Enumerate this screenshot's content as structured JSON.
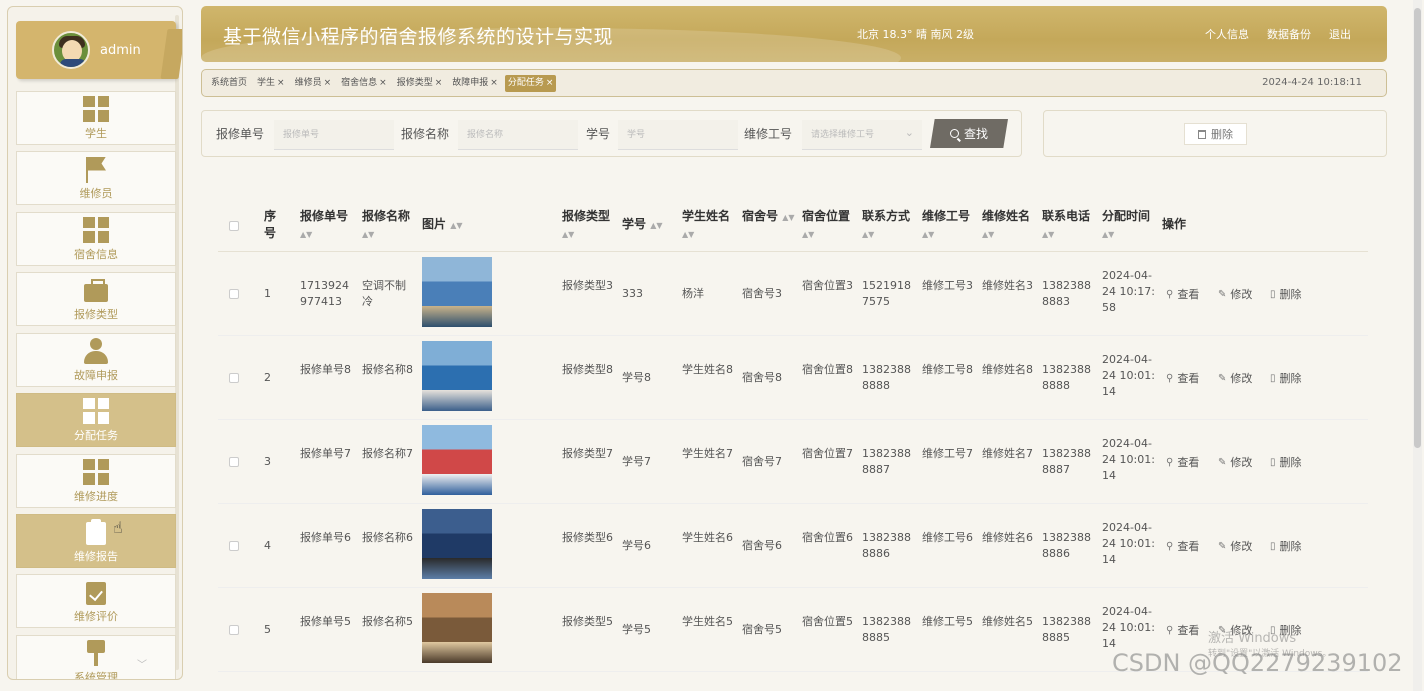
{
  "sidebar": {
    "username": "admin",
    "items": [
      {
        "label": "学生",
        "icon": "grid-icon"
      },
      {
        "label": "维修员",
        "icon": "flag-icon"
      },
      {
        "label": "宿舍信息",
        "icon": "grid-icon"
      },
      {
        "label": "报修类型",
        "icon": "briefcase-icon"
      },
      {
        "label": "故障申报",
        "icon": "user-icon"
      },
      {
        "label": "分配任务",
        "icon": "grid-icon"
      },
      {
        "label": "维修进度",
        "icon": "grid-icon"
      },
      {
        "label": "维修报告",
        "icon": "clipboard-icon"
      },
      {
        "label": "维修评价",
        "icon": "checklist-icon"
      },
      {
        "label": "系统管理",
        "icon": "brush-icon"
      }
    ]
  },
  "header": {
    "title": "基于微信小程序的宿舍报修系统的设计与实现",
    "weather": "北京  18.3°  晴  南风  2级",
    "links": [
      "个人信息",
      "数据备份",
      "退出"
    ]
  },
  "tabs": [
    {
      "label": "系统首页",
      "closable": false
    },
    {
      "label": "学生",
      "closable": true
    },
    {
      "label": "维修员",
      "closable": true
    },
    {
      "label": "宿舍信息",
      "closable": true
    },
    {
      "label": "报修类型",
      "closable": true
    },
    {
      "label": "故障申报",
      "closable": true
    },
    {
      "label": "分配任务",
      "closable": true
    }
  ],
  "datetime": "2024-4-24 10:18:11",
  "search": {
    "fields": [
      {
        "label": "报修单号",
        "placeholder": "报修单号"
      },
      {
        "label": "报修名称",
        "placeholder": "报修名称"
      },
      {
        "label": "学号",
        "placeholder": "学号"
      },
      {
        "label": "维修工号",
        "placeholder": "请选择维修工号"
      }
    ],
    "button": "查找"
  },
  "actions": {
    "delete": "删除"
  },
  "table": {
    "headers": [
      "序号",
      "报修单号",
      "报修名称",
      "图片",
      "报修类型",
      "学号",
      "学生姓名",
      "宿舍号",
      "宿舍位置",
      "联系方式",
      "维修工号",
      "维修姓名",
      "联系电话",
      "分配时间",
      "操作"
    ],
    "ops": [
      "查看",
      "修改",
      "删除"
    ],
    "rows": [
      {
        "no": "1",
        "order": "1713924977413",
        "name": "空调不制冷",
        "type": "报修类型3",
        "sid": "333",
        "sname": "杨洋",
        "room": "宿舍号3",
        "loc": "宿舍位置3",
        "contact": "15219187575",
        "wid": "维修工号3",
        "wname": "维修姓名3",
        "phone": "13823888883",
        "time": "2024-04-24 10:17:58"
      },
      {
        "no": "2",
        "order": "报修单号8",
        "name": "报修名称8",
        "type": "报修类型8",
        "sid": "学号8",
        "sname": "学生姓名8",
        "room": "宿舍号8",
        "loc": "宿舍位置8",
        "contact": "13823888888",
        "wid": "维修工号8",
        "wname": "维修姓名8",
        "phone": "13823888888",
        "time": "2024-04-24 10:01:14"
      },
      {
        "no": "3",
        "order": "报修单号7",
        "name": "报修名称7",
        "type": "报修类型7",
        "sid": "学号7",
        "sname": "学生姓名7",
        "room": "宿舍号7",
        "loc": "宿舍位置7",
        "contact": "13823888887",
        "wid": "维修工号7",
        "wname": "维修姓名7",
        "phone": "13823888887",
        "time": "2024-04-24 10:01:14"
      },
      {
        "no": "4",
        "order": "报修单号6",
        "name": "报修名称6",
        "type": "报修类型6",
        "sid": "学号6",
        "sname": "学生姓名6",
        "room": "宿舍号6",
        "loc": "宿舍位置6",
        "contact": "13823888886",
        "wid": "维修工号6",
        "wname": "维修姓名6",
        "phone": "13823888886",
        "time": "2024-04-24 10:01:14"
      },
      {
        "no": "5",
        "order": "报修单号5",
        "name": "报修名称5",
        "type": "报修类型5",
        "sid": "学号5",
        "sname": "学生姓名5",
        "room": "宿舍号5",
        "loc": "宿舍位置5",
        "contact": "13823888885",
        "wid": "维修工号5",
        "wname": "维修姓名5",
        "phone": "13823888885",
        "time": "2024-04-24 10:01:14"
      }
    ]
  },
  "watermark": {
    "activate": "激活 Windows",
    "activate_sub": "转到\"设置\"以激活 Windows。",
    "csdn": "CSDN @QQ2279239102"
  }
}
